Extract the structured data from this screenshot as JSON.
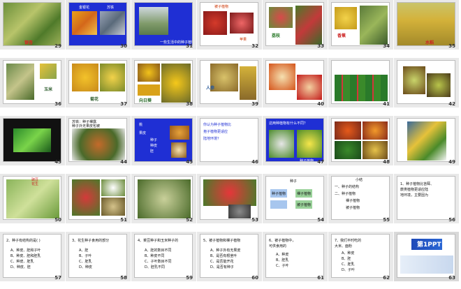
{
  "colors": {
    "blue_bg": "#1f2fd4",
    "green": "#3e7d2e",
    "red": "#cc2222",
    "yellow": "#e6c21a"
  },
  "slides": [
    {
      "n": "29",
      "caption": "银杏",
      "lines": []
    },
    {
      "n": "30",
      "caption": "",
      "lines": [
        "金银花",
        "苏铁"
      ]
    },
    {
      "n": "31",
      "caption": "",
      "lines": [
        "一些生活中的种子植物"
      ]
    },
    {
      "n": "32",
      "caption": "",
      "lines": [
        "被子植物",
        "苹果"
      ]
    },
    {
      "n": "33",
      "caption": "荔枝",
      "lines": []
    },
    {
      "n": "34",
      "caption": "香蕉",
      "lines": []
    },
    {
      "n": "35",
      "caption": "水稻",
      "lines": []
    },
    {
      "n": "36",
      "caption": "玉米",
      "lines": []
    },
    {
      "n": "37",
      "caption": "菊花",
      "lines": []
    },
    {
      "n": "38",
      "caption": "向日葵",
      "lines": []
    },
    {
      "n": "39",
      "caption": "人参",
      "lines": []
    },
    {
      "n": "40",
      "caption": "",
      "lines": []
    },
    {
      "n": "41",
      "caption": "",
      "lines": []
    },
    {
      "n": "42",
      "caption": "",
      "lines": []
    },
    {
      "n": "43",
      "caption": "",
      "lines": []
    },
    {
      "n": "44",
      "caption": "",
      "lines": [
        "苏铁：种子裸露",
        "种子外无果皮包被"
      ]
    },
    {
      "n": "45",
      "caption": "",
      "lines": [
        "桃",
        "果皮",
        "种子",
        "种皮",
        "胚"
      ]
    },
    {
      "n": "46",
      "caption": "",
      "lines": [
        "你认为种子植物比",
        "孢子植物更适应",
        "陆地环境？"
      ]
    },
    {
      "n": "47",
      "caption": "",
      "lines": [
        "这两种植物有什么不同？",
        "种子植物"
      ]
    },
    {
      "n": "48",
      "caption": "",
      "lines": []
    },
    {
      "n": "49",
      "caption": "",
      "lines": []
    },
    {
      "n": "50",
      "caption": "",
      "lines": [
        "豌豆",
        "花生"
      ]
    },
    {
      "n": "51",
      "caption": "",
      "lines": []
    },
    {
      "n": "52",
      "caption": "",
      "lines": []
    },
    {
      "n": "53",
      "caption": "",
      "lines": []
    },
    {
      "n": "54",
      "caption": "",
      "lines": [
        "种子",
        "种子植物",
        "裸子植物",
        "被子植物"
      ]
    },
    {
      "n": "55",
      "caption": "",
      "lines": [
        "小结",
        "一、种子的结构",
        "二、种子植物",
        "裸子植物",
        "被子植物"
      ]
    },
    {
      "n": "56",
      "caption": "",
      "lines": [
        "1、种子植物比苔藓、",
        "蕨类植物更适应陆",
        "地环境，主要因为"
      ]
    },
    {
      "n": "57",
      "caption": "",
      "lines": [
        "2、种子有结构的是( )",
        "A、种皮、胚和子叶",
        "B、种皮、胚和胚乳",
        "C、种皮、胚乳",
        "D、种皮、胚"
      ]
    },
    {
      "n": "58",
      "caption": "",
      "lines": [
        "3、花生种子食用的部分",
        "A、胚",
        "B、子叶",
        "C、胚乳",
        "D、种皮"
      ]
    },
    {
      "n": "59",
      "caption": "",
      "lines": [
        "4、菜豆种子和玉米种子的",
        "A、胚的数目不同",
        "B、种皮不同",
        "C、子叶数目不同",
        "D、胚乳不同"
      ]
    },
    {
      "n": "60",
      "caption": "",
      "lines": [
        "5、被子植物和裸子植物",
        "A、种子外有无果皮",
        "B、是否有根茎叶",
        "C、是否能开花",
        "D、是否有种子"
      ]
    },
    {
      "n": "61",
      "caption": "",
      "lines": [
        "6、被子植物中，",
        "可供食用的",
        "A、种皮",
        "B、胚乳",
        "C、子叶"
      ]
    },
    {
      "n": "62",
      "caption": "",
      "lines": [
        "7、我们平时吃的",
        "大米、面粉",
        "A、种皮",
        "B、胚",
        "C、胚乳",
        "D、子叶"
      ]
    },
    {
      "n": "63",
      "caption": "",
      "lines": [
        "第1PPT"
      ]
    }
  ]
}
